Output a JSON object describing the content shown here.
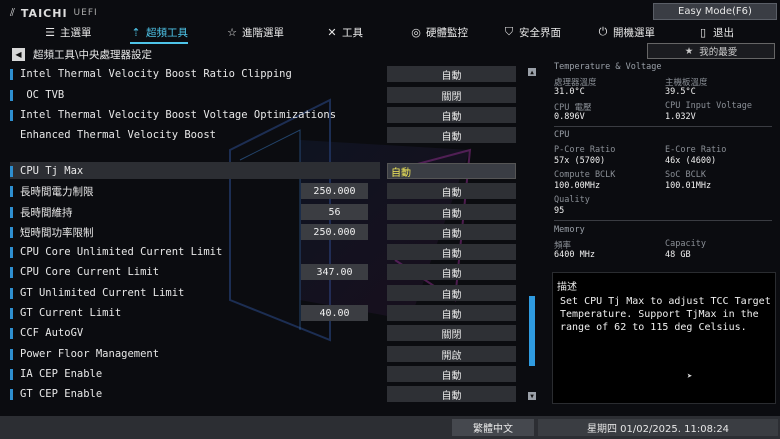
{
  "header": {
    "brand": "TAICHI",
    "uefi": "UEFI",
    "easy_mode": "Easy Mode(F6)"
  },
  "nav": [
    {
      "label": "主選單",
      "icon": "list-icon"
    },
    {
      "label": "超頻工具",
      "icon": "rocket-icon",
      "active": true
    },
    {
      "label": "進階選單",
      "icon": "star-icon"
    },
    {
      "label": "工具",
      "icon": "tools-icon"
    },
    {
      "label": "硬體監控",
      "icon": "monitor-icon"
    },
    {
      "label": "安全界面",
      "icon": "shield-icon"
    },
    {
      "label": "開機選單",
      "icon": "power-icon"
    },
    {
      "label": "退出",
      "icon": "exit-icon"
    }
  ],
  "breadcrumb": "超頻工具\\中央處理器設定",
  "favorites": "我的最愛",
  "settings": [
    {
      "label": "Intel Thermal Velocity Boost Ratio Clipping",
      "value": "自動"
    },
    {
      "label": " OC TVB",
      "value": "關閉"
    },
    {
      "label": "Intel Thermal Velocity Boost Voltage Optimizations",
      "value": "自動"
    },
    {
      "label": "Enhanced Thermal Velocity Boost",
      "value": "自動"
    },
    {
      "label": "CPU Tj Max",
      "value": "自動",
      "selected": true
    },
    {
      "label": "長時間電力制限",
      "num": "250.000",
      "value": "自動"
    },
    {
      "label": "長時間維持",
      "num": "56",
      "value": "自動"
    },
    {
      "label": "短時間功率限制",
      "num": "250.000",
      "value": "自動"
    },
    {
      "label": "CPU Core Unlimited Current Limit",
      "value": "自動"
    },
    {
      "label": "CPU Core Current Limit",
      "num": "347.00",
      "value": "自動"
    },
    {
      "label": "GT Unlimited Current Limit",
      "value": "自動"
    },
    {
      "label": "GT Current Limit",
      "num": "40.00",
      "value": "自動"
    },
    {
      "label": "CCF AutoGV",
      "value": "關閉"
    },
    {
      "label": "Power Floor Management",
      "value": "開啟"
    },
    {
      "label": "IA CEP Enable",
      "value": "自動"
    },
    {
      "label": "GT CEP Enable",
      "value": "自動"
    }
  ],
  "monitor": {
    "temp_heading": "Temperature & Voltage",
    "cpu_temp_label": "處理器溫度",
    "cpu_temp": "31.0°C",
    "mb_temp_label": "主機板溫度",
    "mb_temp": "39.5°C",
    "cpu_volt_label": "CPU 電壓",
    "cpu_volt": "0.896V",
    "cpu_input_label": "CPU Input Voltage",
    "cpu_input": "1.032V",
    "cpu_heading": "CPU",
    "pcore_label": "P-Core Ratio",
    "pcore": "57x (5700)",
    "ecore_label": "E-Core Ratio",
    "ecore": "46x (4600)",
    "bclk_label": "Compute BCLK",
    "bclk": "100.00MHz",
    "soc_label": "SoC BCLK",
    "soc": "100.01MHz",
    "quality_label": "Quality",
    "quality": "95",
    "mem_heading": "Memory",
    "freq_label": "頻率",
    "freq": "6400 MHz",
    "cap_label": "Capacity",
    "cap": "48 GB"
  },
  "description": {
    "title": "描述",
    "text": "Set CPU Tj Max to adjust TCC Target Temperature. Support TjMax in the range of 62 to 115 deg Celsius."
  },
  "footer": {
    "language": "繁體中文",
    "datetime": "星期四 01/02/2025. 11:08:24"
  }
}
